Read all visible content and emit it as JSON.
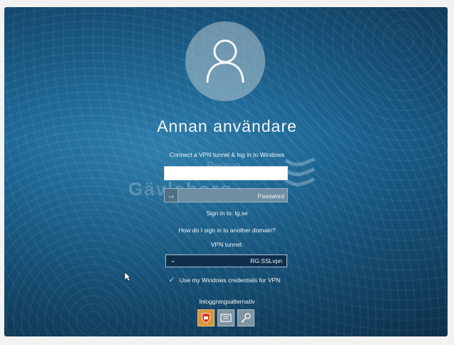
{
  "user": {
    "display_name": "Annan användare"
  },
  "vpn_hint": "Connect a VPN tunnel & log in to Windows",
  "username_field": {
    "value": "",
    "placeholder": ""
  },
  "password_field": {
    "placeholder": "Password"
  },
  "sign_in_domain": "Sign in to: lg.se",
  "help_link": "How do I sign in to another domain?",
  "vpn": {
    "label": "VPN tunnel:",
    "selected": "RG.SSLvpn",
    "use_credentials_label": "Use my Windows credentials for VPN",
    "use_credentials_checked": true
  },
  "sign_in_options_label": "Inloggningsalternativ",
  "watermark": {
    "top": "Region",
    "main": "Gävleborg"
  },
  "colors": {
    "accent": "#d5963a",
    "bg": "#1f6b9a"
  }
}
